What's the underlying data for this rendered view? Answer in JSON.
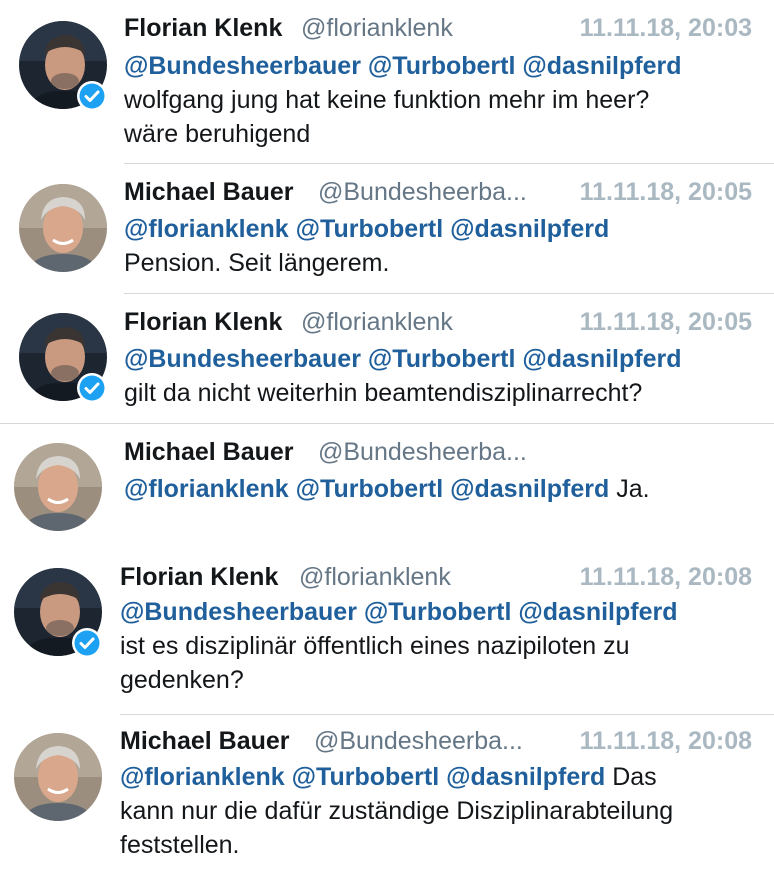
{
  "colors": {
    "mention": "#1f5f9b",
    "timestamp": "#aab8c2",
    "verified": "#1da1f2",
    "divider": "#d6d9dc"
  },
  "tweets": [
    {
      "name": "Florian Klenk",
      "handle": "@florianklenk",
      "time": "11.11.18, 20:03",
      "verified": true,
      "avatar": "florian-avatar",
      "mentions": [
        "@Bundesheerbauer",
        "@Turbobertl",
        "@dasnilpferd"
      ],
      "text_lines": [
        "wolfgang jung hat keine funktion mehr im heer?",
        "wäre beruhigend"
      ]
    },
    {
      "name": "Michael Bauer",
      "handle": "@Bundesheerba...",
      "time": "11.11.18, 20:05",
      "verified": false,
      "avatar": "michael-avatar",
      "mentions": [
        "@florianklenk",
        "@Turbobertl",
        "@dasnilpferd"
      ],
      "text_lines": [
        "Pension. Seit längerem."
      ]
    },
    {
      "name": "Florian Klenk",
      "handle": "@florianklenk",
      "time": "11.11.18, 20:05",
      "verified": true,
      "avatar": "florian-avatar",
      "mentions": [
        "@Bundesheerbauer",
        "@Turbobertl",
        "@dasnilpferd"
      ],
      "text_lines": [
        "gilt da nicht weiterhin beamtendisziplinarrecht?"
      ]
    },
    {
      "name": "Michael Bauer",
      "handle": "@Bundesheerba...",
      "time": "",
      "verified": false,
      "avatar": "michael-avatar",
      "mentions": [
        "@florianklenk",
        "@Turbobertl",
        "@dasnilpferd"
      ],
      "inline_text": "Ja.",
      "text_lines": []
    },
    {
      "name": "Florian Klenk",
      "handle": "@florianklenk",
      "time": "11.11.18, 20:08",
      "verified": true,
      "avatar": "florian-avatar",
      "mentions": [
        "@Bundesheerbauer",
        "@Turbobertl",
        "@dasnilpferd"
      ],
      "text_lines": [
        "ist es disziplinär öffentlich eines nazipiloten zu",
        "gedenken?"
      ]
    },
    {
      "name": "Michael Bauer",
      "handle": "@Bundesheerba...",
      "time": "11.11.18, 20:08",
      "verified": false,
      "avatar": "michael-avatar",
      "mentions": [
        "@florianklenk",
        "@Turbobertl",
        "@dasnilpferd"
      ],
      "inline_text": "Das",
      "text_lines": [
        "kann nur die dafür zuständige Disziplinarabteilung",
        "feststellen."
      ]
    }
  ]
}
